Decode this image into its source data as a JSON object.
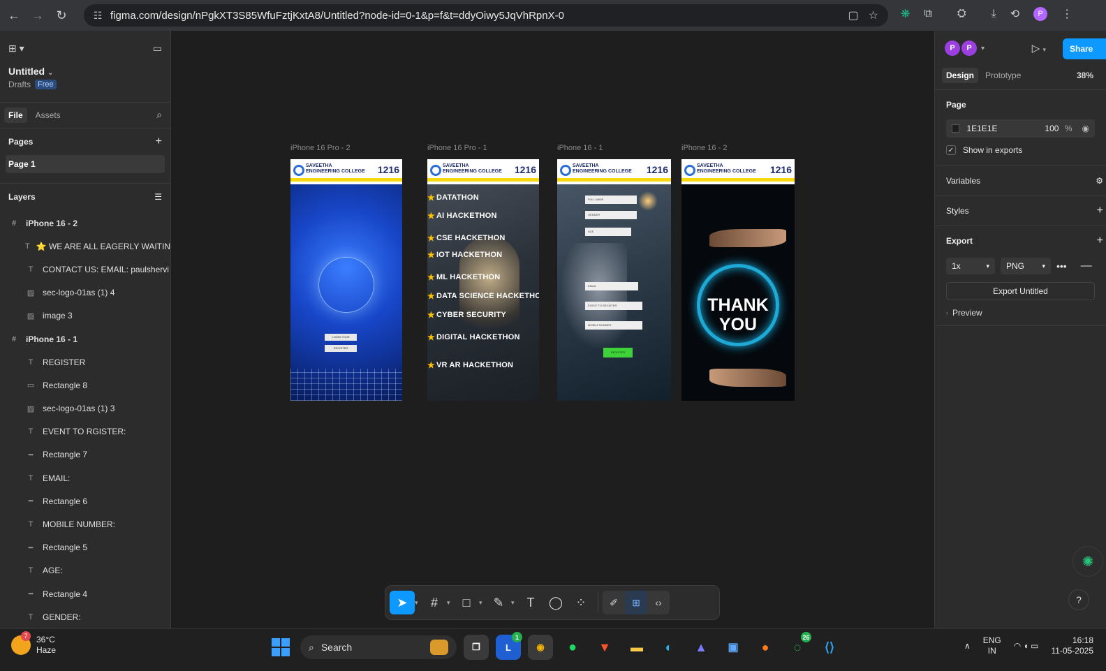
{
  "browser": {
    "url": "figma.com/design/nPgkXT3S85WfuFztjKxtA8/Untitled?node-id=0-1&p=f&t=ddyOiwy5JqVhRpnX-0",
    "profile_initial": "P"
  },
  "file": {
    "title": "Untitled",
    "location": "Drafts",
    "plan_badge": "Free"
  },
  "left_tabs": [
    "File",
    "Assets"
  ],
  "pages": {
    "header": "Pages",
    "items": [
      "Page 1"
    ]
  },
  "layers": {
    "header": "Layers",
    "items": [
      {
        "type": "frame",
        "icon": "#",
        "name": "iPhone 16 - 2"
      },
      {
        "type": "text",
        "icon": "T",
        "name": "⭐ WE ARE ALL EAGERLY WAITIN"
      },
      {
        "type": "text",
        "icon": "T",
        "name": "CONTACT US: EMAIL: paulshervi"
      },
      {
        "type": "image",
        "icon": "▨",
        "name": "sec-logo-01as (1) 4"
      },
      {
        "type": "image",
        "icon": "▨",
        "name": "image 3"
      },
      {
        "type": "frame",
        "icon": "#",
        "name": "iPhone 16 - 1"
      },
      {
        "type": "text",
        "icon": "T",
        "name": "REGISTER"
      },
      {
        "type": "rect",
        "icon": "▭",
        "name": "Rectangle 8"
      },
      {
        "type": "image",
        "icon": "▨",
        "name": "sec-logo-01as (1) 3"
      },
      {
        "type": "text",
        "icon": "T",
        "name": "EVENT TO RGISTER:"
      },
      {
        "type": "rect",
        "icon": "━",
        "name": "Rectangle 7"
      },
      {
        "type": "text",
        "icon": "T",
        "name": "EMAIL:"
      },
      {
        "type": "rect",
        "icon": "━",
        "name": "Rectangle 6"
      },
      {
        "type": "text",
        "icon": "T",
        "name": "MOBILE NUMBER:"
      },
      {
        "type": "rect",
        "icon": "━",
        "name": "Rectangle 5"
      },
      {
        "type": "text",
        "icon": "T",
        "name": "AGE:"
      },
      {
        "type": "rect",
        "icon": "━",
        "name": "Rectangle 4"
      },
      {
        "type": "text",
        "icon": "T",
        "name": "GENDER:"
      }
    ]
  },
  "canvas": {
    "frames": [
      {
        "label": "iPhone 16 Pro - 2"
      },
      {
        "label": "iPhone 16 Pro - 1"
      },
      {
        "label": "iPhone 16 - 1"
      },
      {
        "label": "iPhone 16 - 2"
      }
    ],
    "header": {
      "college": "SAVEETHA",
      "college_sub": "ENGINEERING COLLEGE",
      "code": "1216"
    },
    "login": {
      "login_label": "LOGIN YOUR",
      "register_label": "REGISTER"
    },
    "events": [
      "DATATHON",
      "AI HACKETHON",
      "CSE HACKETHON",
      "IOT HACKETHON",
      "ML HACKETHON",
      "DATA SCIENCE HACKETHON",
      "CYBER SECURITY",
      "DIGITAL HACKETHON",
      "VR AR HACKETHON"
    ],
    "form": {
      "fields": [
        "FULL NAME",
        "GENDER",
        "AGE",
        "EMAIL",
        "EVENT TO REGISTER",
        "MOBILE NUMBER"
      ],
      "register_button": "REGISTER"
    },
    "thanks": {
      "line1": "THANK",
      "line2": "YOU"
    }
  },
  "toolbar": {
    "tools": [
      "move-tool",
      "frame-tool",
      "shape-tool",
      "pen-tool",
      "text-tool",
      "comment-tool",
      "actions-tool"
    ]
  },
  "right_panel": {
    "avatars": [
      "P",
      "P"
    ],
    "share_label": "Share",
    "tabs": [
      "Design",
      "Prototype"
    ],
    "zoom": "38%",
    "page_section": "Page",
    "page_color": "1E1E1E",
    "page_opacity": "100",
    "percent_sign": "%",
    "show_in_exports": "Show in exports",
    "variables": "Variables",
    "styles": "Styles",
    "export": "Export",
    "export_scale": "1x",
    "export_format": "PNG",
    "export_button": "Export Untitled",
    "preview": "Preview"
  },
  "taskbar": {
    "weather_temp": "36°C",
    "weather_desc": "Haze",
    "weather_badge": "7",
    "search_placeholder": "Search",
    "whatsapp_badge": "26",
    "l_badge": "1",
    "lang_top": "ENG",
    "lang_bottom": "IN",
    "time": "16:18",
    "date": "11-05-2025"
  }
}
